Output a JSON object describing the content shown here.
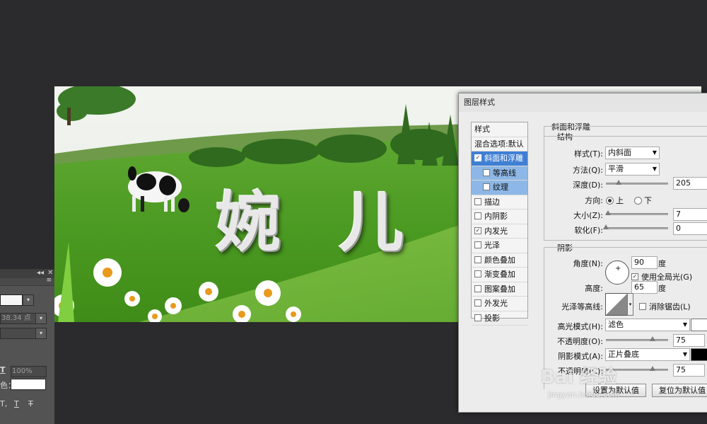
{
  "canvas": {
    "text_chars": [
      "婉",
      "儿"
    ]
  },
  "left_panel": {
    "size_value": "38.34 点",
    "opacity_value": "100%",
    "color_label": "色："
  },
  "dialog": {
    "title": "图层样式",
    "styles_header": "样式",
    "blend_options": "混合选项:默认",
    "items": [
      {
        "label": "斜面和浮雕",
        "checked": true
      },
      {
        "label": "等高线",
        "checked": false
      },
      {
        "label": "纹理",
        "checked": false
      },
      {
        "label": "描边",
        "checked": false
      },
      {
        "label": "内阴影",
        "checked": false
      },
      {
        "label": "内发光",
        "checked": true
      },
      {
        "label": "光泽",
        "checked": false
      },
      {
        "label": "颜色叠加",
        "checked": false
      },
      {
        "label": "渐变叠加",
        "checked": false
      },
      {
        "label": "图案叠加",
        "checked": false
      },
      {
        "label": "外发光",
        "checked": false
      },
      {
        "label": "投影",
        "checked": false
      }
    ],
    "bevel": {
      "title": "斜面和浮雕",
      "structure_title": "结构",
      "style_label": "样式(T):",
      "style_value": "内斜面",
      "technique_label": "方法(Q):",
      "technique_value": "平滑",
      "depth_label": "深度(D):",
      "depth_value": "205",
      "depth_fraction": 0.2,
      "direction_label": "方向:",
      "dir_up": "上",
      "dir_down": "下",
      "size_label": "大小(Z):",
      "size_value": "7",
      "size_fraction": 0.03,
      "soften_label": "软化(F):",
      "soften_value": "0",
      "soften_fraction": 0.0
    },
    "shading": {
      "title": "阴影",
      "angle_label": "角度(N):",
      "angle_value": "90",
      "degree_unit": "度",
      "global_light_label": "使用全局光(G)",
      "global_light_checked": true,
      "altitude_label": "高度:",
      "altitude_value": "65",
      "gloss_contour_label": "光泽等高线:",
      "anti_alias_label": "消除锯齿(L)",
      "highlight_mode_label": "高光模式(H):",
      "highlight_mode_value": "滤色",
      "highlight_opacity_label": "不透明度(O):",
      "highlight_opacity_value": "75",
      "highlight_opacity_fraction": 0.75,
      "highlight_color": "#ffffff",
      "shadow_mode_label": "阴影模式(A):",
      "shadow_mode_value": "正片叠底",
      "shadow_opacity_label": "不透明度(C):",
      "shadow_opacity_value": "75",
      "shadow_opacity_fraction": 0.75,
      "shadow_color": "#000000"
    },
    "buttons": {
      "make_default": "设置为默认值",
      "reset_default": "复位为默认值"
    }
  },
  "watermark": {
    "brand": "Bai 经验",
    "url": "jingyan.baidu.com"
  }
}
